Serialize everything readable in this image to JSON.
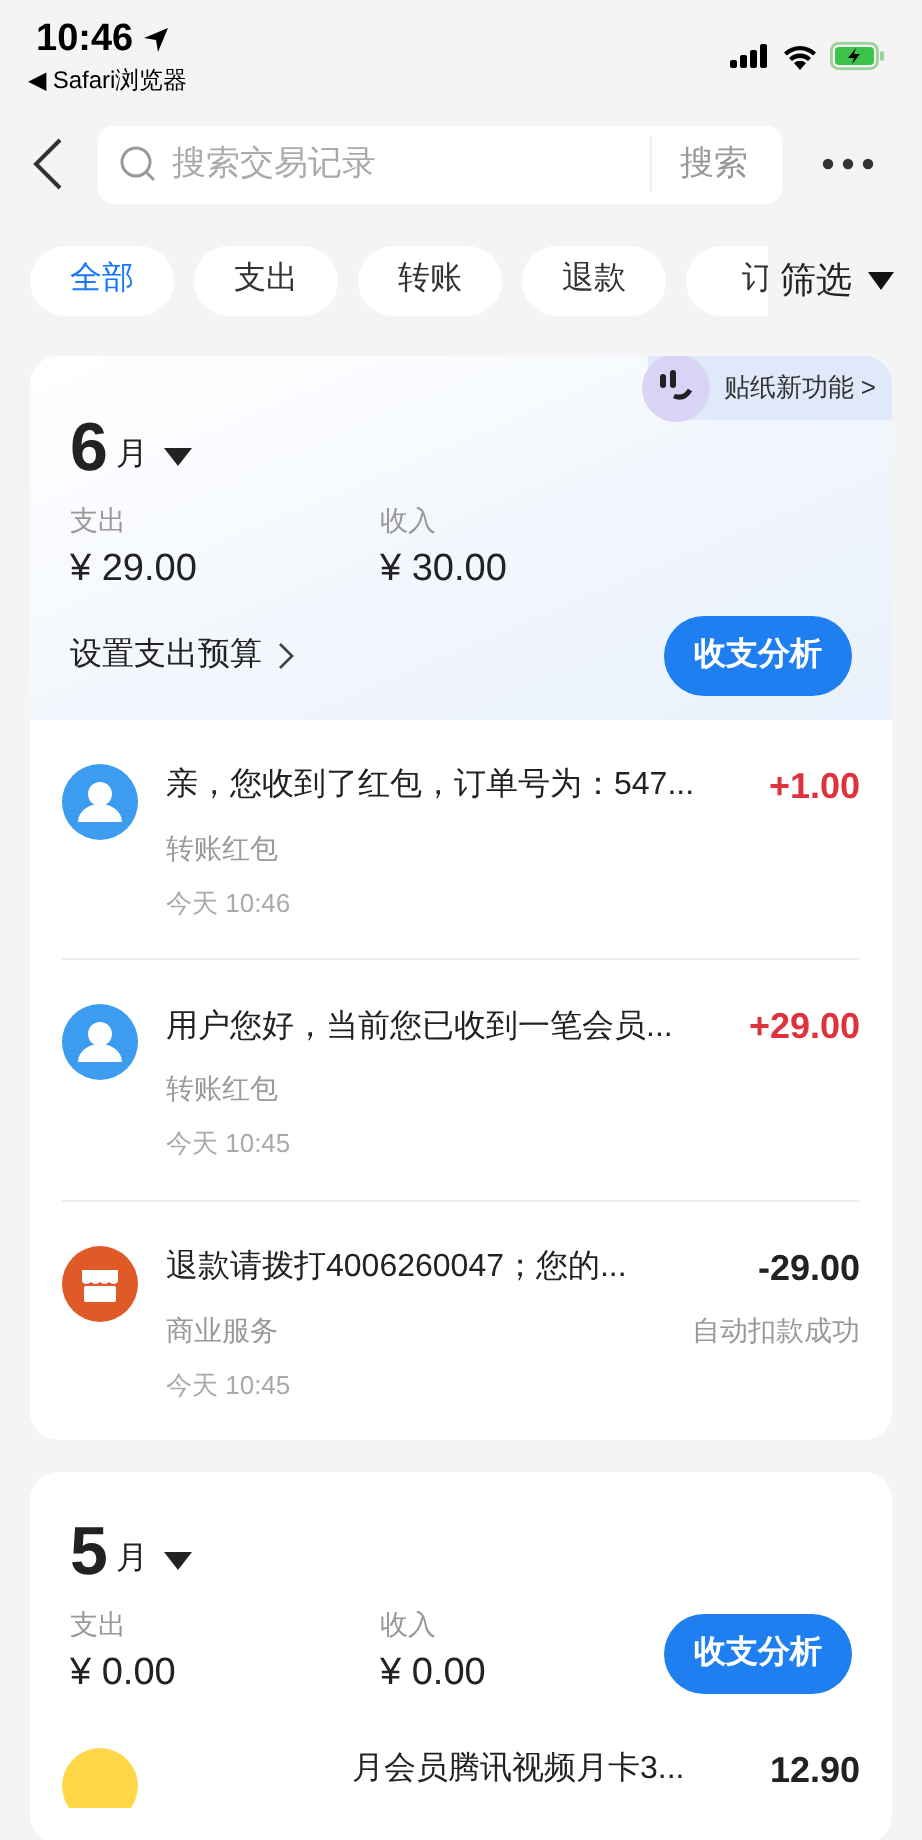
{
  "status_bar": {
    "time": "10:46",
    "back_app": "◀ Safari浏览器"
  },
  "search": {
    "placeholder": "搜索交易记录",
    "button": "搜索"
  },
  "filters": [
    {
      "label": "全部",
      "selected": true
    },
    {
      "label": "支出",
      "selected": false
    },
    {
      "label": "转账",
      "selected": false
    },
    {
      "label": "退款",
      "selected": false
    },
    {
      "label": "订",
      "selected": false
    }
  ],
  "filter_button": "筛选",
  "sticker_promo": "贴纸新功能 >",
  "months": [
    {
      "day": "6",
      "unit": "月",
      "expense_label": "支出",
      "expense": "¥ 29.00",
      "income_label": "收入",
      "income": "¥ 30.00",
      "budget_link": "设置支出预算",
      "analysis_button": "收支分析",
      "transactions": [
        {
          "kind": "person",
          "title": "亲，您收到了红包，订单号为：547...",
          "amount": "+1.00",
          "color": "#e0323c",
          "category": "转账红包",
          "time": "今天 10:46"
        },
        {
          "kind": "person",
          "title": "用户您好，当前您已收到一笔会员...",
          "amount": "+29.00",
          "color": "#e0323c",
          "category": "转账红包",
          "time": "今天 10:45"
        },
        {
          "kind": "shop",
          "title": "退款请拨打4006260047；您的...",
          "amount": "-29.00",
          "color": "#222222",
          "category": "商业服务",
          "status": "自动扣款成功",
          "time": "今天 10:45"
        }
      ]
    },
    {
      "day": "5",
      "unit": "月",
      "expense_label": "支出",
      "expense": "¥ 0.00",
      "income_label": "收入",
      "income": "¥ 0.00",
      "analysis_button": "收支分析",
      "transactions": [
        {
          "kind": "app",
          "title": "月会员腾讯视频月卡3...",
          "amount": "12.90",
          "color": "#222222"
        }
      ]
    }
  ]
}
